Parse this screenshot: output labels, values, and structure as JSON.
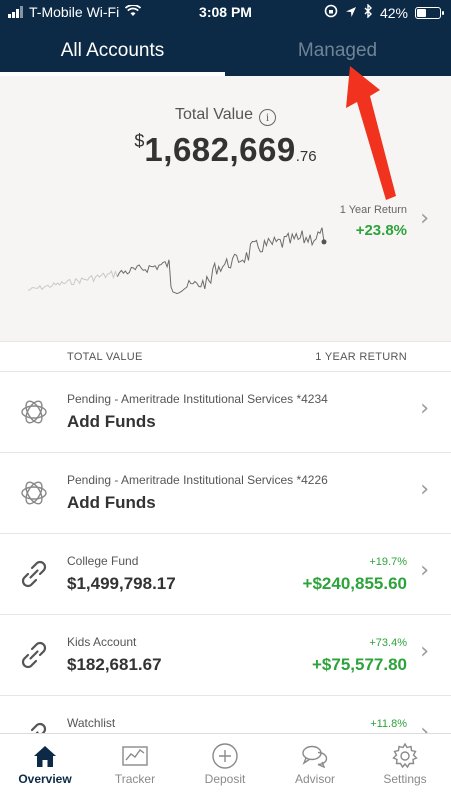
{
  "status_bar": {
    "carrier": "T-Mobile Wi-Fi",
    "time": "3:08 PM",
    "battery": "42%",
    "battery_level": 0.42
  },
  "tabs": [
    {
      "label": "All Accounts",
      "active": true
    },
    {
      "label": "Managed",
      "active": false
    }
  ],
  "summary": {
    "total_label": "Total Value",
    "currency": "$",
    "total_whole": "1,682,669",
    "total_cents": ".76",
    "return_label": "1 Year Return",
    "return_value": "+23.8%"
  },
  "columns": {
    "left": "TOTAL VALUE",
    "right": "1 YEAR RETURN"
  },
  "accounts": [
    {
      "icon": "pending-funds-icon",
      "subtitle": "Pending - Ameritrade Institutional Services *4234",
      "title": "Add Funds",
      "return_pct": "",
      "return_value": ""
    },
    {
      "icon": "pending-funds-icon",
      "subtitle": "Pending - Ameritrade Institutional Services *4226",
      "title": "Add Funds",
      "return_pct": "",
      "return_value": ""
    },
    {
      "icon": "link-icon",
      "subtitle": "College Fund",
      "title": "$1,499,798.17",
      "return_pct": "+19.7%",
      "return_value": "+$240,855.60"
    },
    {
      "icon": "link-icon",
      "subtitle": "Kids Account",
      "title": "$182,681.67",
      "return_pct": "+73.4%",
      "return_value": "+$75,577.80"
    },
    {
      "icon": "link-icon",
      "subtitle": "Watchlist",
      "title": "",
      "return_pct": "+11.8%",
      "return_value": ""
    }
  ],
  "bottom_nav": [
    {
      "label": "Overview",
      "icon": "home-icon",
      "active": true
    },
    {
      "label": "Tracker",
      "icon": "chart-icon",
      "active": false
    },
    {
      "label": "Deposit",
      "icon": "plus-circle-icon",
      "active": false
    },
    {
      "label": "Advisor",
      "icon": "chat-bubbles-icon",
      "active": false
    },
    {
      "label": "Settings",
      "icon": "gear-icon",
      "active": false
    }
  ],
  "colors": {
    "header": "#0c2a45",
    "positive": "#2ea33c",
    "annotation_arrow": "#f0321e"
  }
}
